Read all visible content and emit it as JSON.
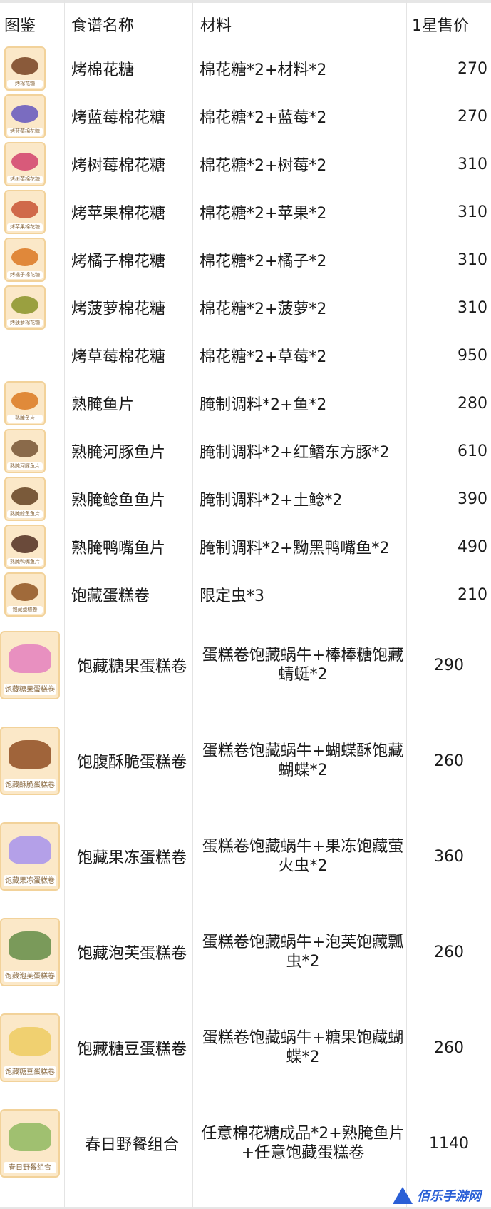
{
  "headers": {
    "picture": "图鉴",
    "name": "食谱名称",
    "materials": "材料",
    "price": "1星售价"
  },
  "rows": [
    {
      "name": "烤棉花糖",
      "materials": "棉花糖*2+材料*2",
      "price": "270",
      "thumb_label": "烤棉花糖",
      "color": "#8a5a3a"
    },
    {
      "name": "烤蓝莓棉花糖",
      "materials": "棉花糖*2+蓝莓*2",
      "price": "270",
      "thumb_label": "烤蓝莓棉花糖",
      "color": "#7a6cc0"
    },
    {
      "name": "烤树莓棉花糖",
      "materials": "棉花糖*2+树莓*2",
      "price": "310",
      "thumb_label": "烤树莓棉花糖",
      "color": "#d85a7a"
    },
    {
      "name": "烤苹果棉花糖",
      "materials": "棉花糖*2+苹果*2",
      "price": "310",
      "thumb_label": "烤苹果棉花糖",
      "color": "#d06a4a"
    },
    {
      "name": "烤橘子棉花糖",
      "materials": "棉花糖*2+橘子*2",
      "price": "310",
      "thumb_label": "烤橘子棉花糖",
      "color": "#e0883a"
    },
    {
      "name": "烤菠萝棉花糖",
      "materials": "棉花糖*2+菠萝*2",
      "price": "310",
      "thumb_label": "烤菠萝棉花糖",
      "color": "#9aa040"
    },
    {
      "name": "烤草莓棉花糖",
      "materials": "棉花糖*2+草莓*2",
      "price": "950",
      "thumb_label": "",
      "color": ""
    },
    {
      "name": "熟腌鱼片",
      "materials": "腌制调料*2+鱼*2",
      "price": "280",
      "thumb_label": "熟腌鱼片",
      "color": "#e08a3a"
    },
    {
      "name": "熟腌河豚鱼片",
      "materials": "腌制调料*2+红鳍东方豚*2",
      "price": "610",
      "thumb_label": "熟腌河豚鱼片",
      "color": "#8a6a4a"
    },
    {
      "name": "熟腌鲶鱼鱼片",
      "materials": "腌制调料*2+土鲶*2",
      "price": "390",
      "thumb_label": "熟腌鲶鱼鱼片",
      "color": "#7a5a3a"
    },
    {
      "name": "熟腌鸭嘴鱼片",
      "materials": "腌制调料*2+黝黑鸭嘴鱼*2",
      "price": "490",
      "thumb_label": "熟腌鸭嘴鱼片",
      "color": "#6a4a3a"
    },
    {
      "name": "饱藏蛋糕卷",
      "materials": "限定虫*3",
      "price": "210",
      "thumb_label": "饱藏蛋糕卷",
      "color": "#a06a3a"
    },
    {
      "name": "饱藏糖果蛋糕卷",
      "materials": "蛋糕卷饱藏蜗牛+棒棒糖饱藏蜻蜓*2",
      "price": "290",
      "thumb_label": "饱藏糖果蛋糕卷",
      "color": "#e890c0"
    },
    {
      "name": "饱腹酥脆蛋糕卷",
      "materials": "蛋糕卷饱藏蜗牛+蝴蝶酥饱藏蝴蝶*2",
      "price": "260",
      "thumb_label": "饱藏酥脆蛋糕卷",
      "color": "#a0643a"
    },
    {
      "name": "饱藏果冻蛋糕卷",
      "materials": "蛋糕卷饱藏蜗牛+果冻饱藏萤火虫*2",
      "price": "360",
      "thumb_label": "饱藏果冻蛋糕卷",
      "color": "#b4a0e8"
    },
    {
      "name": "饱藏泡芙蛋糕卷",
      "materials": "蛋糕卷饱藏蜗牛+泡芙饱藏瓢虫*2",
      "price": "260",
      "thumb_label": "饱藏泡芙蛋糕卷",
      "color": "#7a9a5a"
    },
    {
      "name": "饱藏糖豆蛋糕卷",
      "materials": "蛋糕卷饱藏蜗牛+糖果饱藏蝴蝶*2",
      "price": "260",
      "thumb_label": "饱藏糖豆蛋糕卷",
      "color": "#f0d070"
    },
    {
      "name": "春日野餐组合",
      "materials": "任意棉花糖成品*2+熟腌鱼片+任意饱藏蛋糕卷",
      "price": "1140",
      "thumb_label": "春日野餐组合",
      "color": "#a0c070"
    }
  ],
  "watermark": {
    "text": "佰乐手游网",
    "color": "#2a5fd6"
  }
}
